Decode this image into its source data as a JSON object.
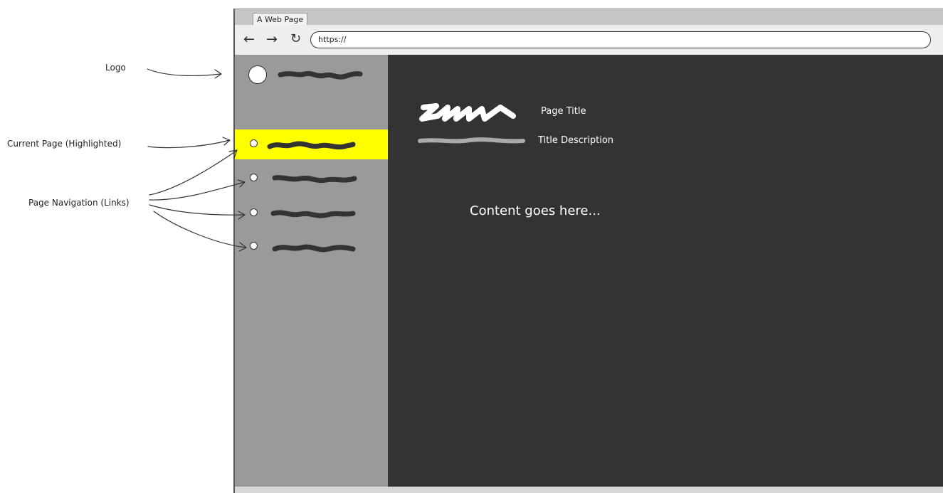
{
  "annotations": {
    "logo": "Logo",
    "current_page": "Current Page (Highlighted)",
    "page_navigation": "Page Navigation (Links)"
  },
  "browser": {
    "tab_title": "A Web Page",
    "back_icon": "arrow-left-icon",
    "forward_icon": "arrow-right-icon",
    "reload_icon": "reload-icon",
    "address": "https://"
  },
  "main": {
    "page_title": "Page Title",
    "title_description": "Title Description",
    "content": "Content goes here..."
  },
  "colors": {
    "sidebar": "#9a9a9a",
    "main": "#333333",
    "highlight": "#ffff00"
  }
}
